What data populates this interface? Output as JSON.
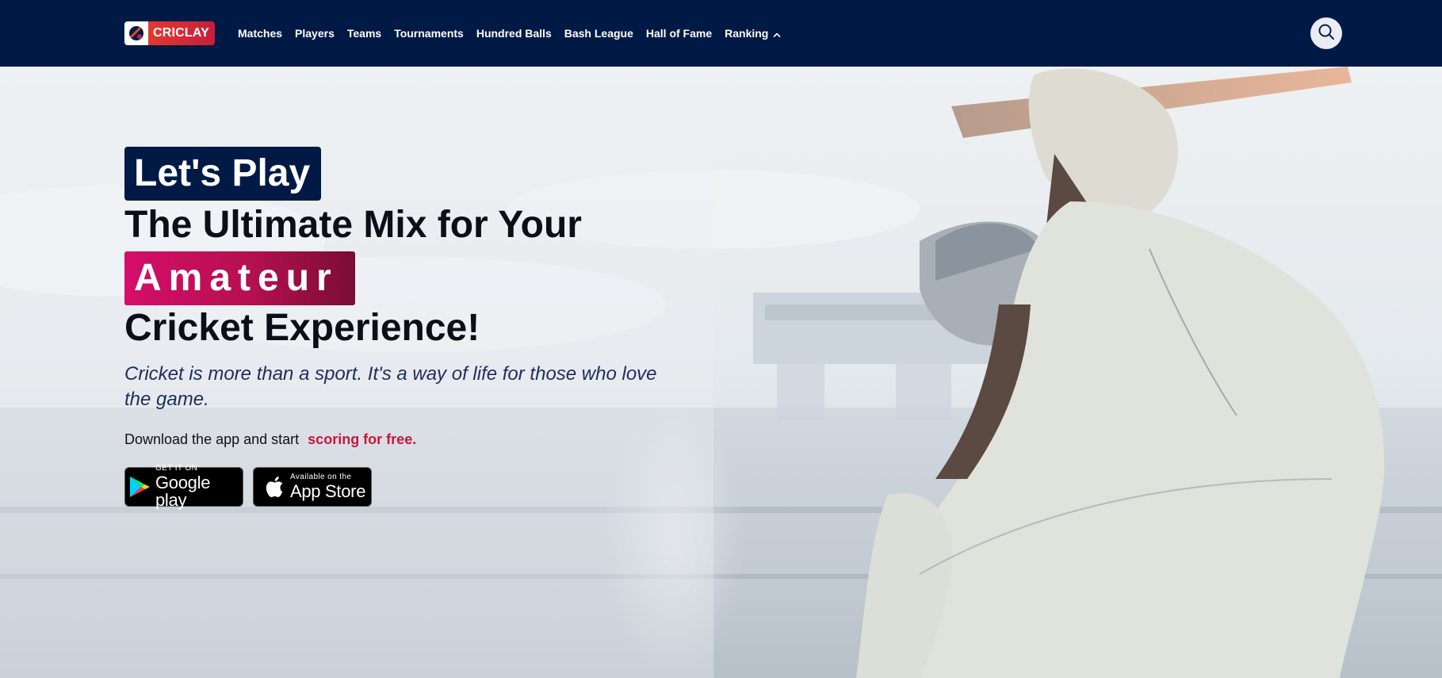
{
  "brand": {
    "name": "CRICLAY"
  },
  "nav": {
    "items": [
      "Matches",
      "Players",
      "Teams",
      "Tournaments",
      "Hundred Balls",
      "Bash League",
      "Hall of Fame"
    ],
    "ranking": "Ranking"
  },
  "hero": {
    "badge": "Let's Play",
    "line1": "The Ultimate Mix for Your",
    "highlight": "Amateur",
    "line2": "Cricket Experience!",
    "tagline": "Cricket is more than a sport. It's a way of life for those who love the game.",
    "download_text": "Download the app and start",
    "download_highlight": "scoring for free."
  },
  "stores": {
    "google": {
      "small": "GET IT ON",
      "big": "Google play"
    },
    "apple": {
      "small": "Available on the",
      "big": "App Store"
    }
  },
  "colors": {
    "navbar": "#011a45",
    "accent": "#c8163f",
    "highlight_gradient_start": "#d50e6a",
    "highlight_gradient_end": "#7a0d33"
  },
  "icons": [
    "search-icon",
    "chevron-up-icon",
    "google-play-icon",
    "apple-icon"
  ]
}
